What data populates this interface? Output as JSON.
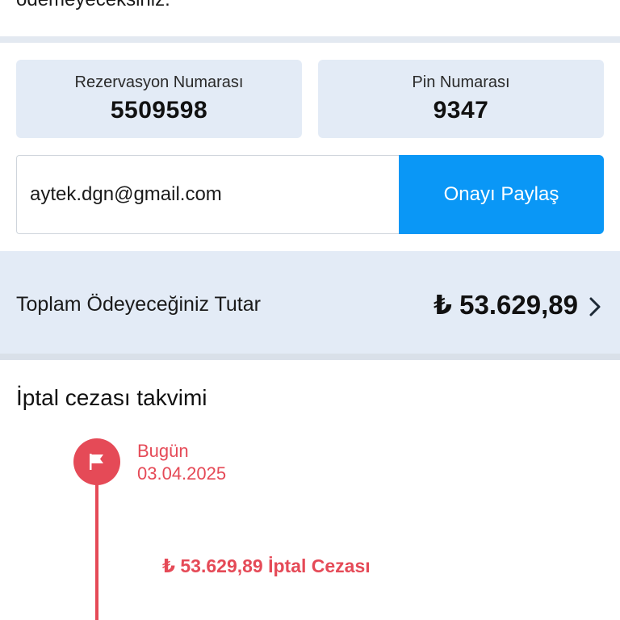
{
  "top_text": "ödemeyeceksiniz.",
  "reservation": {
    "label": "Rezervasyon Numarası",
    "value": "5509598"
  },
  "pin": {
    "label": "Pin Numarası",
    "value": "9347"
  },
  "share": {
    "email": "aytek.dgn@gmail.com",
    "button_label": "Onayı Paylaş"
  },
  "total": {
    "label": "Toplam Ödeyeceğiniz Tutar",
    "value": "₺ 53.629,89"
  },
  "cancellation": {
    "title": "İptal cezası takvimi",
    "today_label": "Bugün",
    "today_date": "03.04.2025",
    "penalty_text": "₺ 53.629,89 İptal Cezası"
  },
  "colors": {
    "accent_blue": "#0a97f6",
    "card_bg": "#e3ebf6",
    "timeline_red": "#e54a57"
  },
  "icons": [
    "flag-icon",
    "chevron-right-icon"
  ]
}
